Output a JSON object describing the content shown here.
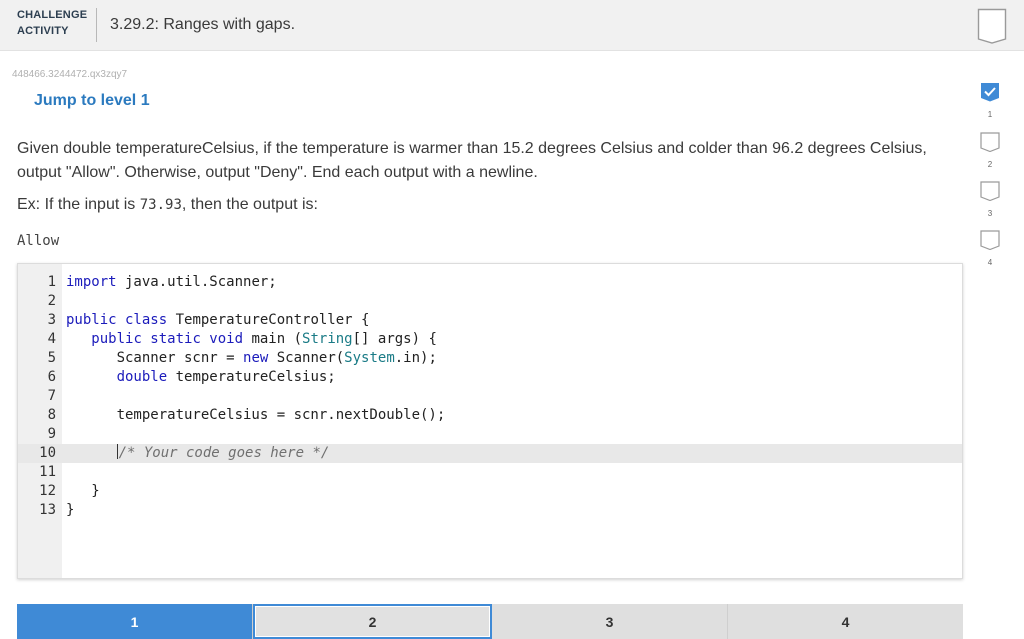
{
  "header": {
    "badge_line1": "CHALLENGE",
    "badge_line2": "ACTIVITY",
    "title": "3.29.2: Ranges with gaps."
  },
  "activity_code": "448466.3244472.qx3zqy7",
  "jump_link": "Jump to level 1",
  "prompt": {
    "description": "Given double temperatureCelsius, if the temperature is warmer than 15.2 degrees Celsius and colder than 96.2 degrees Celsius, output \"Allow\". Otherwise, output \"Deny\". End each output with a newline.",
    "example_prefix": "Ex: If the input is ",
    "example_input": "73.93",
    "example_suffix": ", then the output is:",
    "sample_output": "Allow"
  },
  "editor": {
    "line_numbers": [
      "1",
      "2",
      "3",
      "4",
      "5",
      "6",
      "7",
      "8",
      "9",
      "10",
      "11",
      "12",
      "13"
    ],
    "lines": {
      "l1_kw": "import",
      "l1_rest": " java.util.Scanner;",
      "l3_kw": "public class",
      "l3_rest": " TemperatureController {",
      "l4_indent": "   ",
      "l4_kw": "public static void",
      "l4_mid": " main (",
      "l4_ty": "String",
      "l4_rest": "[] args) {",
      "l5_indent": "      Scanner scnr = ",
      "l5_kw": "new",
      "l5_mid": " Scanner(",
      "l5_ty": "System",
      "l5_rest": ".in);",
      "l6_indent": "      ",
      "l6_kw": "double",
      "l6_rest": " temperatureCelsius;",
      "l8_text": "      temperatureCelsius = scnr.nextDouble();",
      "l10_indent": "      ",
      "l10_comment": "/* Your code goes here */",
      "l12_text": "   }",
      "l13_text": "}"
    },
    "active_line": 10
  },
  "levels": [
    {
      "label": "1",
      "state": "done"
    },
    {
      "label": "2",
      "state": "current"
    },
    {
      "label": "3",
      "state": "pending"
    },
    {
      "label": "4",
      "state": "pending"
    }
  ],
  "progress": {
    "numbers": [
      "1",
      "2",
      "3",
      "4"
    ],
    "completed": [
      true,
      false,
      false,
      false
    ]
  },
  "colors": {
    "accent": "#3f8ad6",
    "link": "#2b7abf",
    "keyword": "#1b1bbb",
    "type": "#1a7b86"
  },
  "icons": {
    "bookmark": "bookmark-icon",
    "check": "checkmark-icon"
  }
}
